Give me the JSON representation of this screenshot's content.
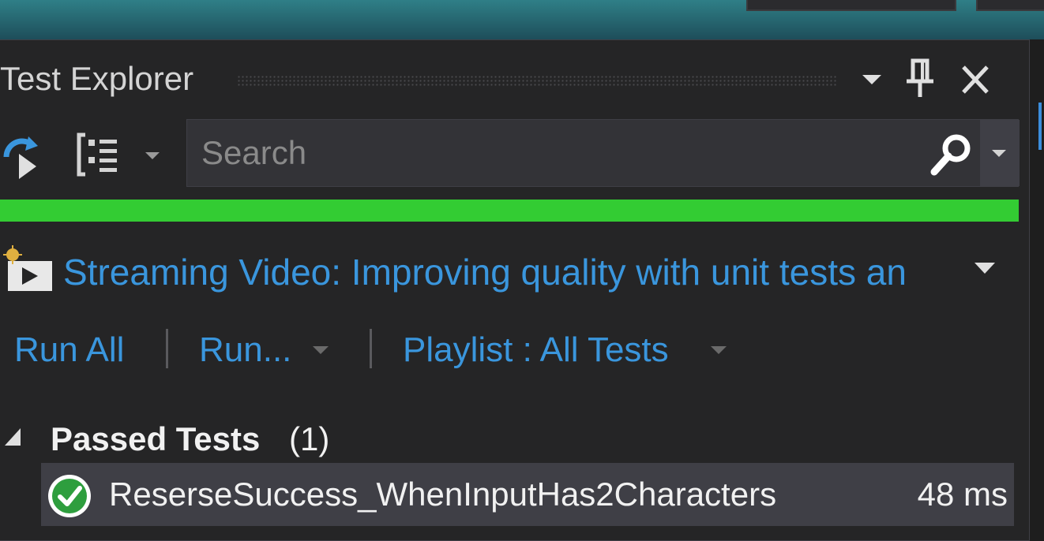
{
  "panel": {
    "title": "Test Explorer"
  },
  "toolbar": {
    "search_placeholder": "Search"
  },
  "progress": {
    "fraction": 1.0,
    "color": "#33cc33"
  },
  "project": {
    "label": "Streaming Video: Improving quality with unit tests an"
  },
  "actions": {
    "run_all": "Run All",
    "run_menu": "Run...",
    "playlist": "Playlist : All Tests"
  },
  "results": {
    "group_label": "Passed Tests",
    "group_count": "(1)",
    "tests": [
      {
        "name": "ReserseSuccess_WhenInputHas2Characters",
        "duration": "48 ms",
        "status": "passed"
      }
    ]
  },
  "colors": {
    "link": "#3a96dd",
    "pass": "#33cc33",
    "text": "#f1f1f1"
  },
  "icons": [
    "refresh-icon",
    "group-by-icon",
    "search-icon",
    "pin-icon",
    "close-icon",
    "dropdown-icon",
    "video-project-icon",
    "collapse-icon",
    "pass-check-icon"
  ]
}
